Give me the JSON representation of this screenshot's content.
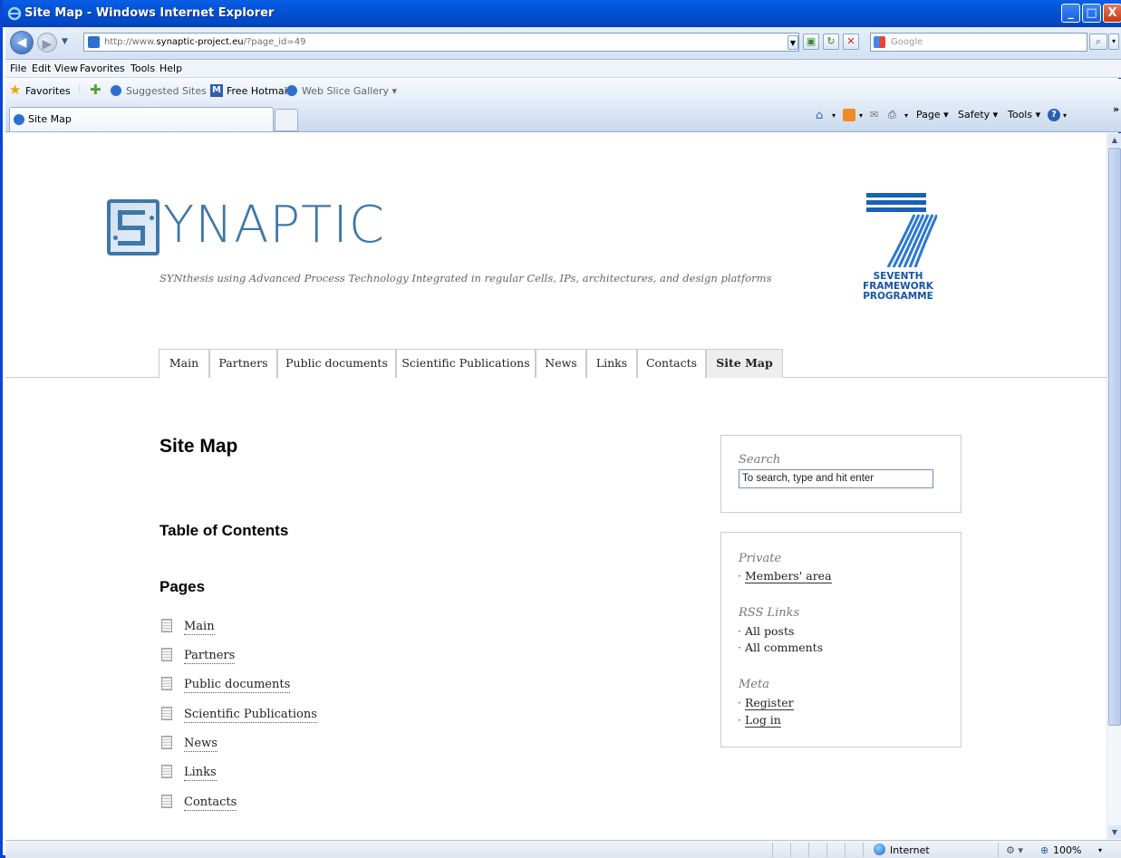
{
  "window": {
    "title": "Site Map - Windows Internet Explorer",
    "minimize": "_",
    "maximize": "□",
    "close": "X"
  },
  "address": {
    "url_prefix": "http://www.",
    "url_domain": "synaptic-project.eu",
    "url_suffix": "/?page_id=49",
    "search_placeholder": "Google"
  },
  "menu": [
    "File",
    "Edit",
    "View",
    "Favorites",
    "Tools",
    "Help"
  ],
  "favorites": {
    "label": "Favorites",
    "items": [
      "Suggested Sites ▾",
      "Free Hotmail",
      "Web Slice Gallery ▾"
    ]
  },
  "tab": {
    "label": "Site Map"
  },
  "command_bar": [
    "Page ▾",
    "Safety ▾",
    "Tools ▾"
  ],
  "site": {
    "logo_word": "YNAPTIC",
    "tagline": "SYNthesis using Advanced Process Technology Integrated in regular Cells, IPs, architectures, and design platforms",
    "fp7_line1": "SEVENTH FRAMEWORK",
    "fp7_line2": "PROGRAMME",
    "nav": [
      {
        "label": "Main"
      },
      {
        "label": "Partners"
      },
      {
        "label": "Public documents"
      },
      {
        "label": "Scientific Publications"
      },
      {
        "label": "News"
      },
      {
        "label": "Links"
      },
      {
        "label": "Contacts"
      },
      {
        "label": "Site Map"
      }
    ]
  },
  "content": {
    "title": "Site Map",
    "toc": "Table of Contents",
    "pages_heading": "Pages",
    "pages": [
      "Main",
      "Partners",
      "Public documents",
      "Scientific Publications",
      "News",
      "Links",
      "Contacts"
    ]
  },
  "sidebar": {
    "search_label": "Search",
    "search_value": "To search, type and hit enter",
    "private_label": "Private",
    "private_items": [
      "Members' area"
    ],
    "rss_label": "RSS Links",
    "rss_items": [
      "All posts",
      "All comments"
    ],
    "meta_label": "Meta",
    "meta_items": [
      "Register",
      "Log in"
    ]
  },
  "status": {
    "zone": "Internet",
    "zoom": "100%"
  }
}
